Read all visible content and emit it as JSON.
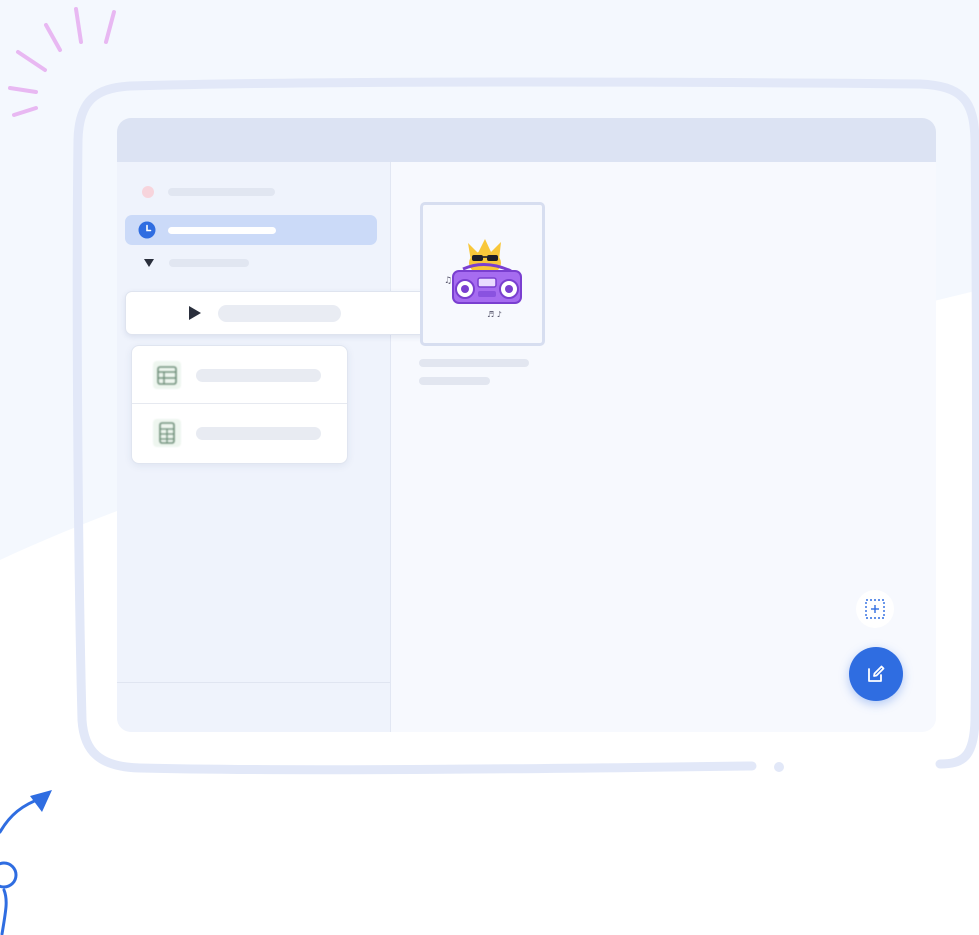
{
  "colors": {
    "accent": "#2f6de1",
    "selected_bg": "#cbdaf8",
    "titlebar": "#dce3f3",
    "sidebar": "#eff3fc",
    "sticker_purple": "#a66cf0",
    "sticker_yellow": "#f8c73a"
  },
  "sidebar": {
    "items": [
      {
        "icon": "red-dot-icon",
        "selected": false
      },
      {
        "icon": "clock-icon",
        "selected": true
      },
      {
        "icon": "triangle-down-icon",
        "selected": false
      }
    ]
  },
  "dragged_row": {
    "icon": "play-icon"
  },
  "popup_card": {
    "items": [
      {
        "icon": "table-doc-icon"
      },
      {
        "icon": "grid-doc-icon"
      }
    ]
  },
  "main": {
    "tile": {
      "icon": "boombox-cat-sticker-icon"
    }
  },
  "actions": {
    "add_frame": "add-frame-icon",
    "compose": "edit-icon"
  }
}
